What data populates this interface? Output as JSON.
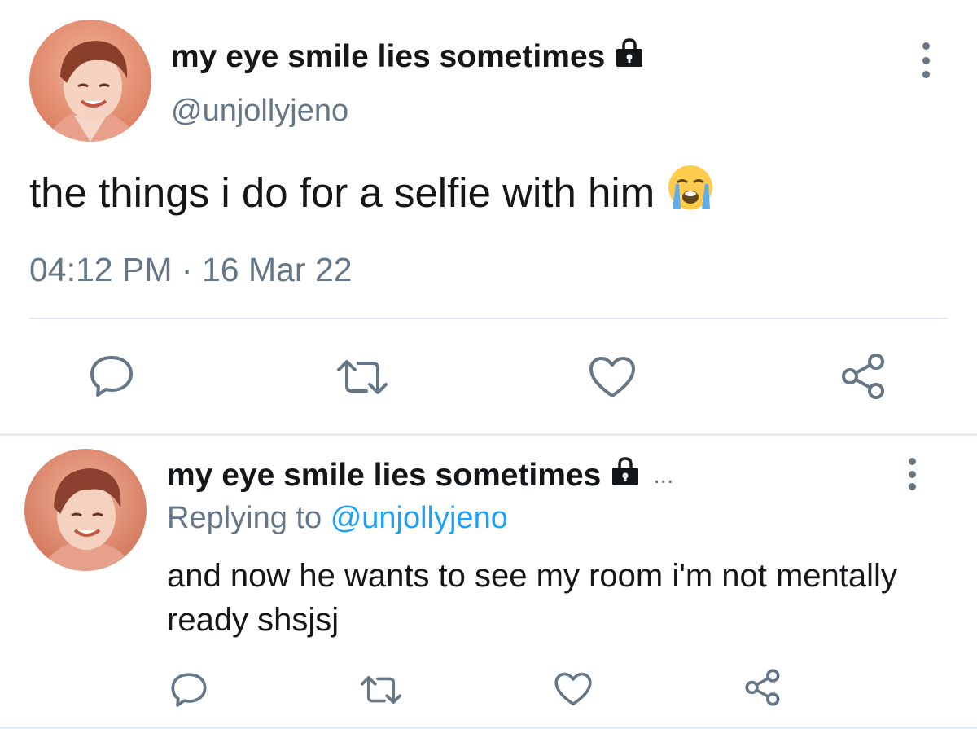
{
  "main_tweet": {
    "display_name": "my eye smile lies sometimes",
    "handle": "@unjollyjeno",
    "text": "the things i do for a selfie with him",
    "emoji": "loudly-crying-face",
    "time": "04:12 PM",
    "separator": "·",
    "date": "16 Mar 22",
    "icons": {
      "lock": "lock-icon",
      "more": "more-vertical-icon",
      "reply": "reply-icon",
      "retweet": "retweet-icon",
      "like": "like-heart-icon",
      "share": "share-icon"
    }
  },
  "reply_tweet": {
    "display_name": "my eye smile lies sometimes",
    "ellipsis": "...",
    "replying_label": "Replying to",
    "replying_handle": "@unjollyjeno",
    "text": "and now he wants to see my room i'm not mentally ready shsjsj"
  },
  "colors": {
    "text": "#14171a",
    "secondary": "#657786",
    "link": "#1da1f2",
    "divider": "#e1e8ed"
  }
}
